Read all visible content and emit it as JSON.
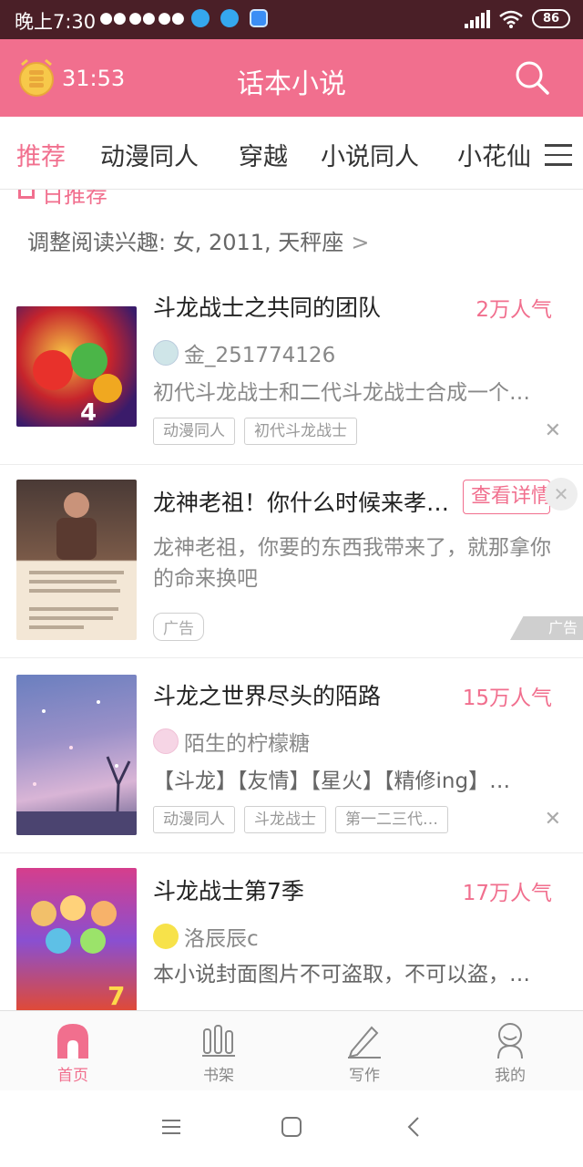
{
  "status_bar": {
    "time": "晚上7:30",
    "battery": "86"
  },
  "header": {
    "timer": "31:53",
    "title": "话本小说"
  },
  "tabs": [
    {
      "label": "推荐",
      "active": true
    },
    {
      "label": "动漫同人"
    },
    {
      "label": "穿越"
    },
    {
      "label": "小说同人"
    },
    {
      "label": "小花仙"
    }
  ],
  "section": {
    "partial_title": "日推荐",
    "interest": "调整阅读兴趣: 女, 2011, 天秤座"
  },
  "items": [
    {
      "title": "斗龙战士之共同的团队",
      "popularity": "2万人气",
      "author": "金_251774126",
      "desc": "初代斗龙战士和二代斗龙战士合成一个…",
      "tags": [
        "动漫同人",
        "初代斗龙战士"
      ]
    },
    {
      "title": "龙神老祖！你什么时候来孝…",
      "button": "查看详情",
      "desc": "龙神老祖，你要的东西我带来了，就那拿你的命来换吧",
      "ad_tag": "广告",
      "ad_mark": "广告"
    },
    {
      "title": "斗龙之世界尽头的陌路",
      "popularity": "15万人气",
      "author": "陌生的柠檬糖",
      "desc": "【斗龙】【友情】【星火】【精修ing】…",
      "tags": [
        "动漫同人",
        "斗龙战士",
        "第一二三代…"
      ]
    },
    {
      "title": "斗龙战士第7季",
      "popularity": "17万人气",
      "author": "洛辰辰c",
      "desc": "本小说封面图片不可盗取，不可以盗，…"
    }
  ],
  "bottom_nav": [
    {
      "label": "首页",
      "icon": "home-icon",
      "active": true
    },
    {
      "label": "书架",
      "icon": "bookshelf-icon"
    },
    {
      "label": "写作",
      "icon": "pen-icon"
    },
    {
      "label": "我的",
      "icon": "profile-icon"
    }
  ],
  "colors": {
    "accent": "#f16f8e",
    "status_bar": "#4a1f27"
  }
}
